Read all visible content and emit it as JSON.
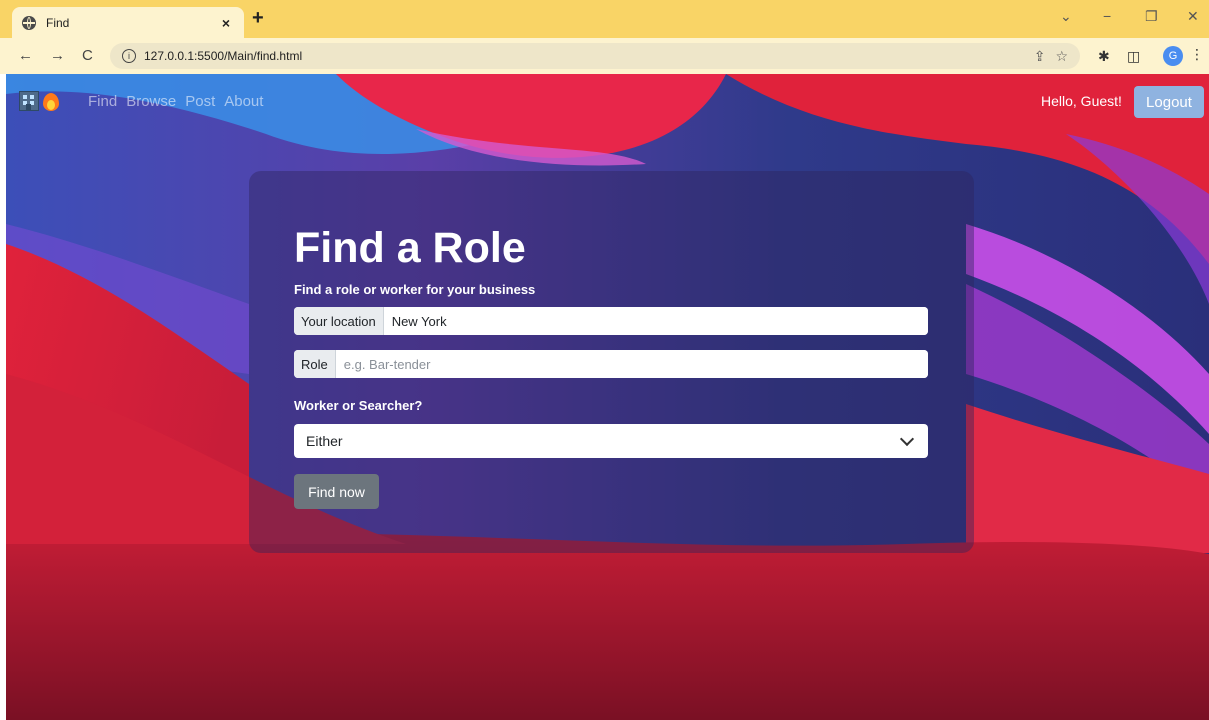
{
  "browser": {
    "tab_title": "Find",
    "tab_close": "×",
    "new_tab": "+",
    "url": "127.0.0.1:5500/Main/find.html",
    "win_down": "⌄",
    "win_minimize": "−",
    "win_restore": "❐",
    "win_close": "✕",
    "back": "←",
    "forward": "→",
    "reload": "C",
    "info": "i",
    "share": "⇪",
    "star": "☆",
    "extensions": "✱",
    "sidepanel": "◫",
    "profile_initial": "G",
    "menu": "⋮"
  },
  "navbar": {
    "links": [
      "Find",
      "Browse",
      "Post",
      "About"
    ],
    "greeting": "Hello, Guest!",
    "logout_label": "Logout",
    "logout_color": "#8fb3e0"
  },
  "form": {
    "title": "Find a Role",
    "subtitle": "Find a role or worker for your business",
    "location_label": "Your location",
    "location_value": "New York",
    "role_label": "Role",
    "role_placeholder": "e.g. Bar-tender",
    "type_label": "Worker or Searcher?",
    "type_selected": "Either",
    "submit_label": "Find now"
  },
  "icons": {
    "logo": [
      "building-icon",
      "fire-icon"
    ],
    "select": "chevron-down-icon"
  },
  "colors": {
    "chrome_tabbar": "#f9d466",
    "chrome_toolbar": "#fdf3cf",
    "button_secondary": "#6c757d"
  }
}
